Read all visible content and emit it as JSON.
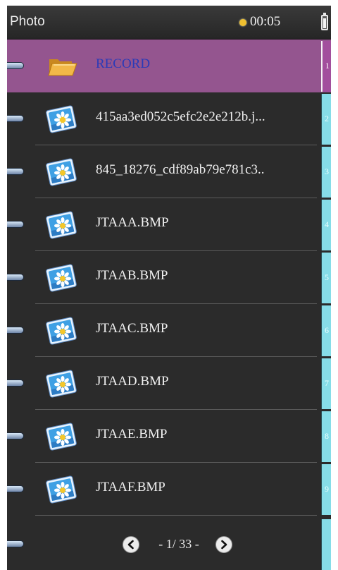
{
  "status_bar": {
    "title": "Photo",
    "time": "00:05"
  },
  "colors": {
    "selected_row": "#94558f",
    "selected_text": "#2a3ab8",
    "index_tab": "#86dde8",
    "background": "#2b2b2b"
  },
  "items": [
    {
      "label": "RECORD",
      "icon": "folder-icon",
      "index": "1",
      "selected": true
    },
    {
      "label": "415aa3ed052c5efc2e2e212b.j...",
      "icon": "photo-icon",
      "index": "2",
      "selected": false
    },
    {
      "label": "845_18276_cdf89ab79e781c3..",
      "icon": "photo-icon",
      "index": "3",
      "selected": false
    },
    {
      "label": "JTAAA.BMP",
      "icon": "photo-icon",
      "index": "4",
      "selected": false
    },
    {
      "label": "JTAAB.BMP",
      "icon": "photo-icon",
      "index": "5",
      "selected": false
    },
    {
      "label": "JTAAC.BMP",
      "icon": "photo-icon",
      "index": "6",
      "selected": false
    },
    {
      "label": "JTAAD.BMP",
      "icon": "photo-icon",
      "index": "7",
      "selected": false
    },
    {
      "label": "JTAAE.BMP",
      "icon": "photo-icon",
      "index": "8",
      "selected": false
    },
    {
      "label": "JTAAF.BMP",
      "icon": "photo-icon",
      "index": "9",
      "selected": false
    }
  ],
  "pager": {
    "text": "- 1/ 33 -",
    "prev_icon": "chevron-left-icon",
    "next_icon": "chevron-right-icon"
  }
}
